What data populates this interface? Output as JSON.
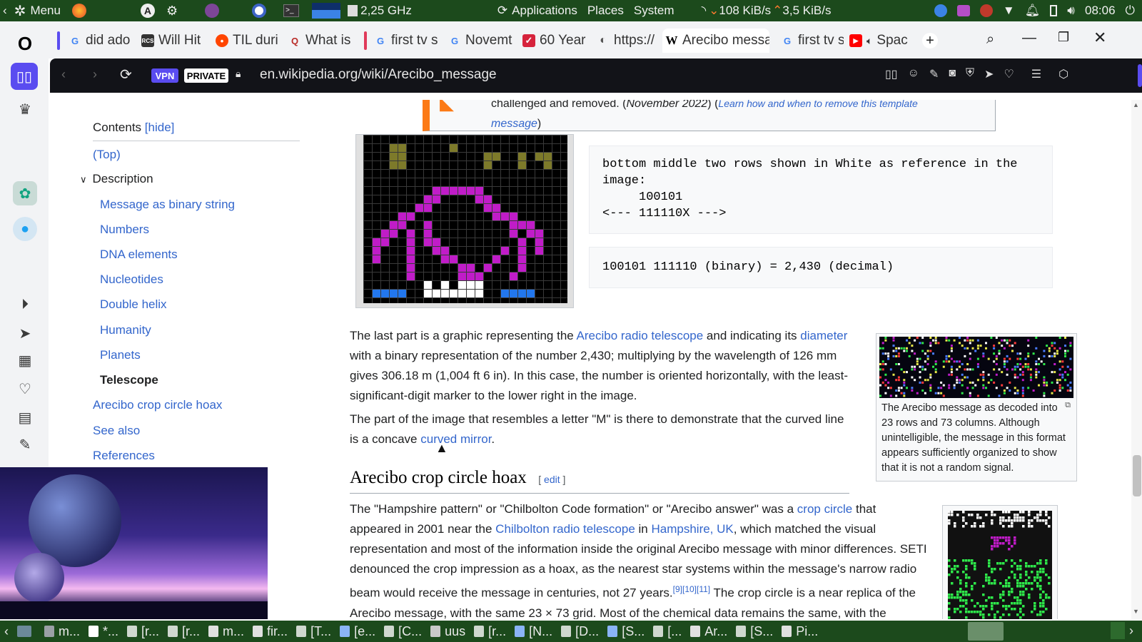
{
  "system_panel": {
    "menu_label": "Menu",
    "cpu_freq": "2,25 GHz",
    "menus": [
      "Applications",
      "Places",
      "System"
    ],
    "net_down": "108 KiB/s",
    "net_up": "3,5 KiB/s",
    "clock": "08:06"
  },
  "tabs": [
    {
      "label": "did ado",
      "fav": "google-icon"
    },
    {
      "label": "Will Hit",
      "fav": "rcs-icon"
    },
    {
      "label": "TIL duri",
      "fav": "reddit-icon"
    },
    {
      "label": "What is",
      "fav": "quora-icon"
    },
    {
      "label": "first tv s",
      "fav": "google-icon"
    },
    {
      "label": "Novemt",
      "fav": "google-icon"
    },
    {
      "label": "60 Year",
      "fav": "bookmark-icon"
    },
    {
      "label": "https://",
      "fav": "globe-icon"
    },
    {
      "label": "Arecibo messa",
      "fav": "wikipedia-icon"
    },
    {
      "label": "first tv s",
      "fav": "google-icon"
    },
    {
      "label": "Spac",
      "fav": "youtube-icon"
    }
  ],
  "addressbar": {
    "vpn_label": "VPN",
    "private_label": "PRIVATE",
    "url": "en.wikipedia.org/wiki/Arecibo_message"
  },
  "notice": {
    "line1_prefix": "challenged and removed. (",
    "date": "November 2022",
    "line1_mid": ") (",
    "learn_link": "Learn how and when to remove this template",
    "line2_link": "message",
    "line2_suffix": ")"
  },
  "toc": {
    "title": "Contents",
    "hide": "[hide]",
    "top": "(Top)",
    "section": "Description",
    "items": [
      "Message as binary string",
      "Numbers",
      "DNA elements",
      "Nucleotides",
      "Double helix",
      "Humanity",
      "Planets",
      "Telescope"
    ],
    "after": [
      "Arecibo crop circle hoax",
      "See also",
      "References"
    ]
  },
  "code_blocks": {
    "block1": [
      "bottom middle two rows shown in White as reference in the",
      "image:",
      "     100101",
      "<--- 111110X --->"
    ],
    "block2": "100101 111110 (binary) = 2,430 (decimal)"
  },
  "article": {
    "p1": {
      "t1": "The last part is a graphic representing the ",
      "l1": "Arecibo radio telescope",
      "t2": " and indicating its ",
      "l2": "diameter",
      "t3": " with a binary representation of the number 2,430; multiplying by the wavelength of 126 mm gives 306.18 m (1,004 ft 6 in). In this case, the number is oriented horizontally, with the least-significant-digit marker to the lower right in the image."
    },
    "p2": {
      "t1": "The part of the image that resembles a letter \"M\" is there to demonstrate that the curved line is a concave ",
      "l1": "curved mirror",
      "t2": "."
    },
    "heading": "Arecibo crop circle hoax",
    "edit": "edit",
    "p3": {
      "t1": "The \"Hampshire pattern\" or \"Chilbolton Code formation\" or \"Arecibo answer\" was a ",
      "l1": "crop circle",
      "t2": " that appeared in 2001 near the ",
      "l2": "Chilbolton radio telescope",
      "t3": " in ",
      "l3": "Hampshire, UK",
      "t4": ", which matched the visual representation and most of the information inside the original Arecibo message with minor differences. SETI denounced the crop impression as a hoax, as the nearest star systems within the message's narrow radio beam would receive the message in centuries, not 27 years.",
      "refs": "[9][10][11]",
      "t5": " The crop circle is a near replica of the Arecibo message, with the same 23 × 73 grid. Most of the chemical data remains the same, with the"
    },
    "caption": "The Arecibo message as decoded into 23 rows and 73 columns. Although unintelligible, the message in this format appears sufficiently organized to show that it is not a random signal."
  },
  "taskbar": [
    {
      "label": "m...",
      "color": "#9aa0a6"
    },
    {
      "label": "*...",
      "color": "#ffffff"
    },
    {
      "label": "[r...",
      "color": "#cfd8cf"
    },
    {
      "label": "[r...",
      "color": "#cfd8cf"
    },
    {
      "label": "m...",
      "color": "#e0e0e0"
    },
    {
      "label": "fir...",
      "color": "#e0e0e0"
    },
    {
      "label": "[T...",
      "color": "#cfd8cf"
    },
    {
      "label": "[e...",
      "color": "#8ab4f8"
    },
    {
      "label": "[C...",
      "color": "#cfd8cf"
    },
    {
      "label": "uus",
      "color": "#c9c9c9"
    },
    {
      "label": "[r...",
      "color": "#cfd8cf"
    },
    {
      "label": "[N...",
      "color": "#8ab4f8"
    },
    {
      "label": "[D...",
      "color": "#cfd8cf"
    },
    {
      "label": "[S...",
      "color": "#8ab4f8"
    },
    {
      "label": "[...",
      "color": "#cfd8cf"
    },
    {
      "label": "Ar...",
      "color": "#e0e0e0"
    },
    {
      "label": "[S...",
      "color": "#cfd8cf"
    },
    {
      "label": "Pi...",
      "color": "#e0e0e0"
    }
  ],
  "colors": {
    "panel_green": "#1c4a1c",
    "link_blue": "#3366cc",
    "notice_orange": "#fc7a16",
    "m_magenta": "#c01cc8",
    "telescope_blue": "#2277ee"
  }
}
